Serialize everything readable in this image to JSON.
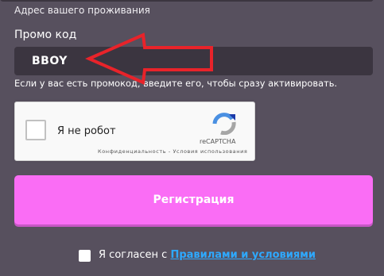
{
  "address_label": "Адрес вашего проживания",
  "promo": {
    "label": "Промо код",
    "value": "BBOY",
    "hint": "Если у вас есть промокод, введите его, чтобы сразу активировать."
  },
  "recaptcha": {
    "label": "Я не робот",
    "brand": "reCAPTCHA",
    "terms": "Конфиденциальность - Условия использования"
  },
  "register_button": "Регистрация",
  "agreement": {
    "prefix": "Я согласен с ",
    "link": "Правилами и условиями"
  },
  "colors": {
    "background": "#57505e",
    "input": "#3b3540",
    "button": "#fa6df5",
    "arrow": "#e8232a",
    "link": "#2ea9ff"
  }
}
